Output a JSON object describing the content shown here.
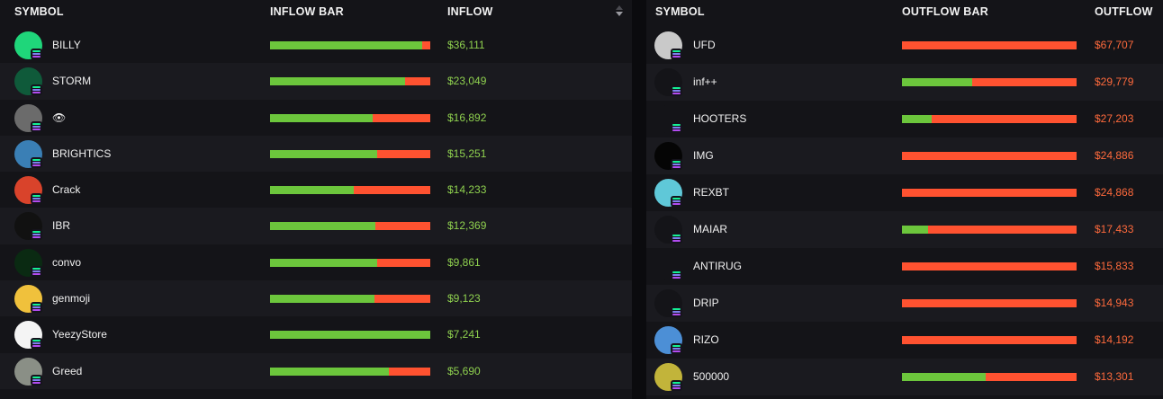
{
  "inflow": {
    "headers": {
      "symbol": "SYMBOL",
      "bar": "INFLOW BAR",
      "amount": "INFLOW"
    },
    "rows": [
      {
        "symbol": "BILLY",
        "amount": "$36,111",
        "green_fraction": 0.95,
        "avatar_color": "#1fd67a",
        "avatar_icon": "ring-icon"
      },
      {
        "symbol": "STORM",
        "amount": "$23,049",
        "green_fraction": 0.84,
        "avatar_color": "#0f5a3a",
        "avatar_icon": "cube-icon"
      },
      {
        "symbol": "👁",
        "amount": "$16,892",
        "green_fraction": 0.64,
        "avatar_color": "#6b6b6b",
        "avatar_icon": "eye-icon"
      },
      {
        "symbol": "BRIGHTICS",
        "amount": "$15,251",
        "green_fraction": 0.67,
        "avatar_color": "#3a7fb5",
        "avatar_icon": "brain-icon"
      },
      {
        "symbol": "Crack",
        "amount": "$14,233",
        "green_fraction": 0.52,
        "avatar_color": "#d9432b",
        "avatar_icon": "character-icon"
      },
      {
        "symbol": "IBR",
        "amount": "$12,369",
        "green_fraction": 0.66,
        "avatar_color": "#111111",
        "avatar_icon": "bitcoin-icon"
      },
      {
        "symbol": "convo",
        "amount": "$9,861",
        "green_fraction": 0.67,
        "avatar_color": "#0a2a12",
        "avatar_icon": "waveform-icon"
      },
      {
        "symbol": "genmoji",
        "amount": "$9,123",
        "green_fraction": 0.65,
        "avatar_color": "#f0c13c",
        "avatar_icon": "smiley-icon"
      },
      {
        "symbol": "YeezyStore",
        "amount": "$7,241",
        "green_fraction": 1.0,
        "avatar_color": "#f4f4f4",
        "avatar_icon": "face-icon"
      },
      {
        "symbol": "Greed",
        "amount": "$5,690",
        "green_fraction": 0.74,
        "avatar_color": "#8a8f86",
        "avatar_icon": "creature-icon"
      }
    ]
  },
  "outflow": {
    "headers": {
      "symbol": "SYMBOL",
      "bar": "OUTFLOW BAR",
      "amount": "OUTFLOW"
    },
    "rows": [
      {
        "symbol": "UFD",
        "amount": "$67,707",
        "green_fraction": 0.0,
        "avatar_color": "#c9c9c9",
        "avatar_icon": "figure-icon"
      },
      {
        "symbol": "inf++",
        "amount": "$29,779",
        "green_fraction": 0.4,
        "avatar_color": "#141418",
        "avatar_icon": "infinity-icon"
      },
      {
        "symbol": "HOOTERS",
        "amount": "$27,203",
        "green_fraction": 0.17,
        "avatar_color": "#141418",
        "avatar_icon": "blank-icon"
      },
      {
        "symbol": "IMG",
        "amount": "$24,886",
        "green_fraction": 0.0,
        "avatar_color": "#050505",
        "avatar_icon": "img-tag-icon"
      },
      {
        "symbol": "REXBT",
        "amount": "$24,868",
        "green_fraction": 0.0,
        "avatar_color": "#5fc8d8",
        "avatar_icon": "solana-icon"
      },
      {
        "symbol": "MAIAR",
        "amount": "$17,433",
        "green_fraction": 0.15,
        "avatar_color": "#141418",
        "avatar_icon": "maiar-logo-icon"
      },
      {
        "symbol": "ANTIRUG",
        "amount": "$15,833",
        "green_fraction": 0.0,
        "avatar_color": "#141418",
        "avatar_icon": "blank-icon"
      },
      {
        "symbol": "DRIP",
        "amount": "$14,943",
        "green_fraction": 0.0,
        "avatar_color": "#141418",
        "avatar_icon": "triangle-icon"
      },
      {
        "symbol": "RIZO",
        "amount": "$14,192",
        "green_fraction": 0.0,
        "avatar_color": "#4c8fd6",
        "avatar_icon": "hedgehog-icon"
      },
      {
        "symbol": "500000",
        "amount": "$13,301",
        "green_fraction": 0.48,
        "avatar_color": "#c2b43a",
        "avatar_icon": "character-icon"
      }
    ]
  },
  "colors": {
    "green": "#6cc63c",
    "red": "#ff5230",
    "inflow_text": "#8fd14f",
    "outflow_text": "#ff6a3c"
  }
}
